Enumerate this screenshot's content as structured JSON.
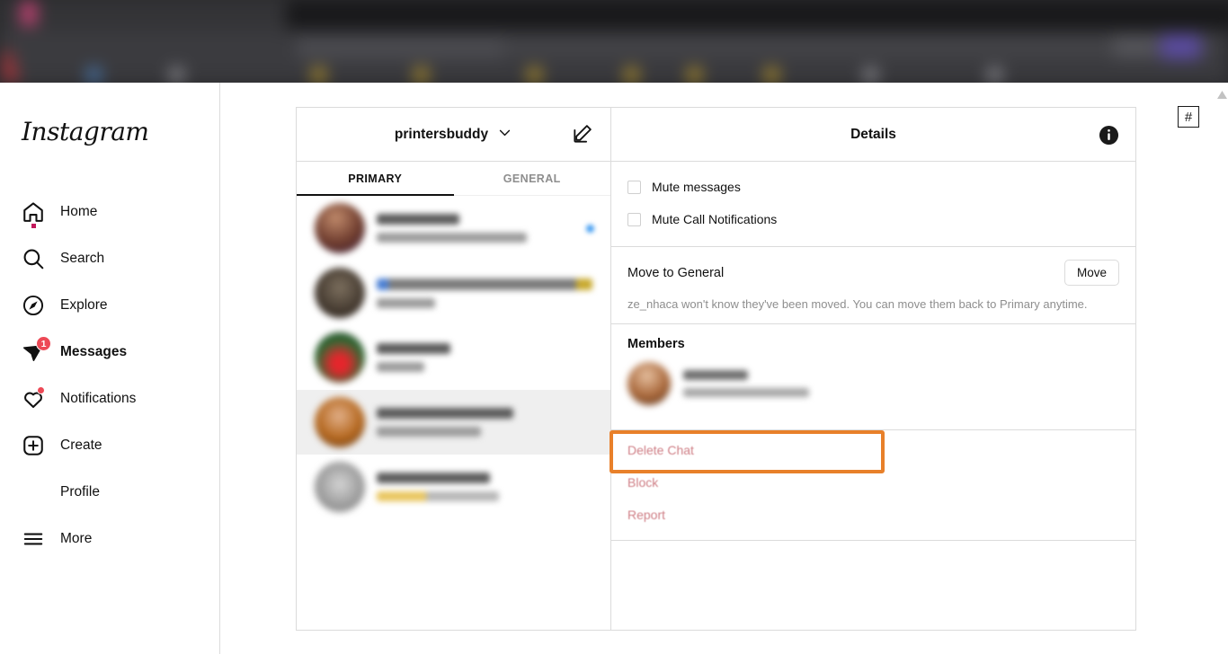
{
  "sidebar": {
    "logo_text": "Instagram",
    "items": [
      {
        "label": "Home",
        "icon": "home-icon",
        "badge": "",
        "active": false
      },
      {
        "label": "Search",
        "icon": "search-icon",
        "badge": "",
        "active": false
      },
      {
        "label": "Explore",
        "icon": "compass-icon",
        "badge": "",
        "active": false
      },
      {
        "label": "Messages",
        "icon": "paper-plane-icon",
        "badge": "1",
        "active": true
      },
      {
        "label": "Notifications",
        "icon": "heart-icon",
        "badge": "",
        "active": false
      },
      {
        "label": "Create",
        "icon": "plus-square-icon",
        "badge": "",
        "active": false
      },
      {
        "label": "Profile",
        "icon": "avatar-icon",
        "badge": "",
        "active": false
      },
      {
        "label": "More",
        "icon": "hamburger-icon",
        "badge": "",
        "active": false
      }
    ]
  },
  "chat_list": {
    "account_name": "printersbuddy",
    "chevron_icon": "chevron-down-icon",
    "compose_icon": "compose-icon",
    "tabs": [
      {
        "label": "PRIMARY",
        "active": true
      },
      {
        "label": "GENERAL",
        "active": false
      }
    ],
    "conversations": [
      {
        "name": "",
        "snippet": "",
        "unread": true,
        "selected": false
      },
      {
        "name": "",
        "snippet": "",
        "unread": false,
        "selected": false
      },
      {
        "name": "",
        "snippet": "",
        "unread": false,
        "selected": false
      },
      {
        "name": "",
        "snippet": "",
        "unread": false,
        "selected": true
      },
      {
        "name": "",
        "snippet": "",
        "unread": false,
        "selected": false
      }
    ]
  },
  "details": {
    "title": "Details",
    "info_icon": "info-circle-icon",
    "options": [
      {
        "label": "Mute messages",
        "checked": false
      },
      {
        "label": "Mute Call Notifications",
        "checked": false
      }
    ],
    "move_section": {
      "title": "Move to General",
      "button_label": "Move",
      "description": "ze_nhaca won't know they've been moved. You can move them back to Primary anytime."
    },
    "members_section": {
      "title": "Members",
      "members": [
        {
          "name": "",
          "subtitle": ""
        }
      ]
    },
    "actions": [
      {
        "label": "Delete Chat",
        "highlighted": true
      },
      {
        "label": "Block",
        "highlighted": false
      },
      {
        "label": "Report",
        "highlighted": false
      }
    ]
  },
  "overlay": {
    "hash_widget_label": "#"
  },
  "colors": {
    "accent_highlight": "#e8802a",
    "danger_text": "#cf7f86",
    "badge_red": "#ed4956",
    "unread_blue": "#3897f0",
    "border_grey": "#dbdbdb",
    "muted_text": "#8e8e8e"
  }
}
